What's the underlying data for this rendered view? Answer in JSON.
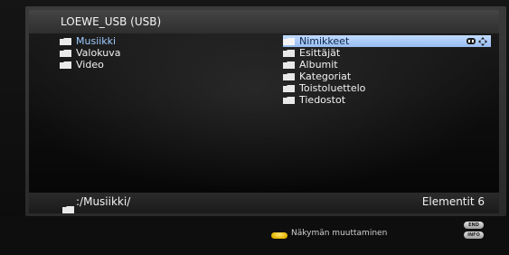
{
  "window": {
    "title": "LOEWE_USB (USB)"
  },
  "source_list": {
    "items": [
      {
        "label": "Musiikki",
        "icon": "folder-icon",
        "active": true
      },
      {
        "label": "Valokuva",
        "icon": "folder-icon",
        "active": false
      },
      {
        "label": "Video",
        "icon": "folder-icon",
        "active": false
      }
    ]
  },
  "category_list": {
    "items": [
      {
        "label": "Nimikkeet",
        "icon": "folder-icon",
        "selected": true
      },
      {
        "label": "Esittäjät",
        "icon": "folder-icon",
        "selected": false
      },
      {
        "label": "Albumit",
        "icon": "folder-icon",
        "selected": false
      },
      {
        "label": "Kategoriat",
        "icon": "folder-icon",
        "selected": false
      },
      {
        "label": "Toistoluettelo",
        "icon": "folder-icon",
        "selected": false
      },
      {
        "label": "Tiedostot",
        "icon": "folder-icon",
        "selected": false
      }
    ],
    "selected_row_icons": [
      "ok-key-icon",
      "dpad-arrows-icon"
    ]
  },
  "footer": {
    "path": ":/Musiikki/",
    "count_label": "Elementit 6",
    "icon": "folder-icon"
  },
  "help_bar": {
    "yellow_key_label": "Näkymän muuttaminen",
    "end_key_label": "END",
    "info_key_label": "INFO",
    "key_color": "#e6b800"
  },
  "colors": {
    "selection": "#b7d2f8",
    "active_text": "#9ecbff",
    "background": "#000000"
  }
}
